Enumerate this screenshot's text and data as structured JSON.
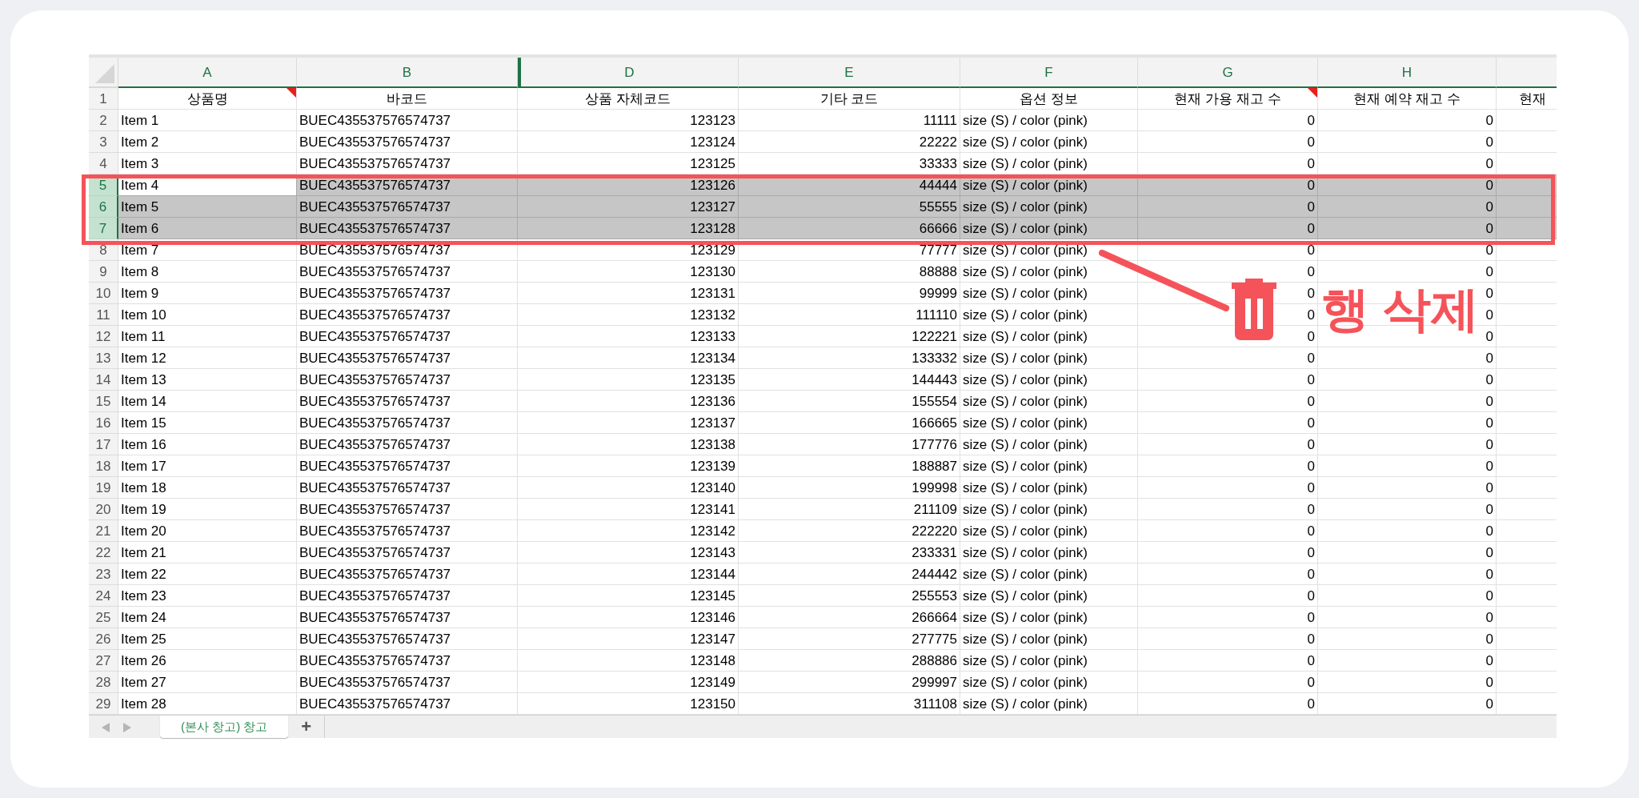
{
  "column_letters": [
    "A",
    "B",
    "D",
    "E",
    "F",
    "G",
    "H"
  ],
  "header_row": {
    "number": "1",
    "cells": [
      {
        "text": "상품명",
        "comment": true
      },
      {
        "text": "바코드",
        "comment": false
      },
      {
        "text": "상품 자체코드",
        "comment": false
      },
      {
        "text": "기타 코드",
        "comment": false
      },
      {
        "text": "옵션 정보",
        "comment": false
      },
      {
        "text": "현재 가용 재고 수",
        "comment": true
      },
      {
        "text": "현재 예약 재고 수",
        "comment": false
      },
      {
        "text": "현재",
        "comment": false
      }
    ]
  },
  "rows": [
    {
      "number": "2",
      "selected": false,
      "active": false,
      "cells": [
        "Item 1",
        "BUEC435537576574737",
        "123123",
        "11111",
        "size (S) / color (pink)",
        "0",
        "0"
      ]
    },
    {
      "number": "3",
      "selected": false,
      "active": false,
      "cells": [
        "Item 2",
        "BUEC435537576574737",
        "123124",
        "22222",
        "size (S) / color (pink)",
        "0",
        "0"
      ]
    },
    {
      "number": "4",
      "selected": false,
      "active": false,
      "cells": [
        "Item 3",
        "BUEC435537576574737",
        "123125",
        "33333",
        "size (S) / color (pink)",
        "0",
        "0"
      ]
    },
    {
      "number": "5",
      "selected": true,
      "active": true,
      "cells": [
        "Item 4",
        "BUEC435537576574737",
        "123126",
        "44444",
        "size (S) / color (pink)",
        "0",
        "0"
      ]
    },
    {
      "number": "6",
      "selected": true,
      "active": false,
      "cells": [
        "Item 5",
        "BUEC435537576574737",
        "123127",
        "55555",
        "size (S) / color (pink)",
        "0",
        "0"
      ]
    },
    {
      "number": "7",
      "selected": true,
      "active": false,
      "cells": [
        "Item 6",
        "BUEC435537576574737",
        "123128",
        "66666",
        "size (S) / color (pink)",
        "0",
        "0"
      ]
    },
    {
      "number": "8",
      "selected": false,
      "active": false,
      "cells": [
        "Item 7",
        "BUEC435537576574737",
        "123129",
        "77777",
        "size (S) / color (pink)",
        "0",
        "0"
      ]
    },
    {
      "number": "9",
      "selected": false,
      "active": false,
      "cells": [
        "Item 8",
        "BUEC435537576574737",
        "123130",
        "88888",
        "size (S) / color (pink)",
        "0",
        "0"
      ]
    },
    {
      "number": "10",
      "selected": false,
      "active": false,
      "cells": [
        "Item 9",
        "BUEC435537576574737",
        "123131",
        "99999",
        "size (S) / color (pink)",
        "0",
        "0"
      ]
    },
    {
      "number": "11",
      "selected": false,
      "active": false,
      "cells": [
        "Item 10",
        "BUEC435537576574737",
        "123132",
        "111110",
        "size (S) / color (pink)",
        "0",
        "0"
      ]
    },
    {
      "number": "12",
      "selected": false,
      "active": false,
      "cells": [
        "Item 11",
        "BUEC435537576574737",
        "123133",
        "122221",
        "size (S) / color (pink)",
        "0",
        "0"
      ]
    },
    {
      "number": "13",
      "selected": false,
      "active": false,
      "cells": [
        "Item 12",
        "BUEC435537576574737",
        "123134",
        "133332",
        "size (S) / color (pink)",
        "0",
        "0"
      ]
    },
    {
      "number": "14",
      "selected": false,
      "active": false,
      "cells": [
        "Item 13",
        "BUEC435537576574737",
        "123135",
        "144443",
        "size (S) / color (pink)",
        "0",
        "0"
      ]
    },
    {
      "number": "15",
      "selected": false,
      "active": false,
      "cells": [
        "Item 14",
        "BUEC435537576574737",
        "123136",
        "155554",
        "size (S) / color (pink)",
        "0",
        "0"
      ]
    },
    {
      "number": "16",
      "selected": false,
      "active": false,
      "cells": [
        "Item 15",
        "BUEC435537576574737",
        "123137",
        "166665",
        "size (S) / color (pink)",
        "0",
        "0"
      ]
    },
    {
      "number": "17",
      "selected": false,
      "active": false,
      "cells": [
        "Item 16",
        "BUEC435537576574737",
        "123138",
        "177776",
        "size (S) / color (pink)",
        "0",
        "0"
      ]
    },
    {
      "number": "18",
      "selected": false,
      "active": false,
      "cells": [
        "Item 17",
        "BUEC435537576574737",
        "123139",
        "188887",
        "size (S) / color (pink)",
        "0",
        "0"
      ]
    },
    {
      "number": "19",
      "selected": false,
      "active": false,
      "cells": [
        "Item 18",
        "BUEC435537576574737",
        "123140",
        "199998",
        "size (S) / color (pink)",
        "0",
        "0"
      ]
    },
    {
      "number": "20",
      "selected": false,
      "active": false,
      "cells": [
        "Item 19",
        "BUEC435537576574737",
        "123141",
        "211109",
        "size (S) / color (pink)",
        "0",
        "0"
      ]
    },
    {
      "number": "21",
      "selected": false,
      "active": false,
      "cells": [
        "Item 20",
        "BUEC435537576574737",
        "123142",
        "222220",
        "size (S) / color (pink)",
        "0",
        "0"
      ]
    },
    {
      "number": "22",
      "selected": false,
      "active": false,
      "cells": [
        "Item 21",
        "BUEC435537576574737",
        "123143",
        "233331",
        "size (S) / color (pink)",
        "0",
        "0"
      ]
    },
    {
      "number": "23",
      "selected": false,
      "active": false,
      "cells": [
        "Item 22",
        "BUEC435537576574737",
        "123144",
        "244442",
        "size (S) / color (pink)",
        "0",
        "0"
      ]
    },
    {
      "number": "24",
      "selected": false,
      "active": false,
      "cells": [
        "Item 23",
        "BUEC435537576574737",
        "123145",
        "255553",
        "size (S) / color (pink)",
        "0",
        "0"
      ]
    },
    {
      "number": "25",
      "selected": false,
      "active": false,
      "cells": [
        "Item 24",
        "BUEC435537576574737",
        "123146",
        "266664",
        "size (S) / color (pink)",
        "0",
        "0"
      ]
    },
    {
      "number": "26",
      "selected": false,
      "active": false,
      "cells": [
        "Item 25",
        "BUEC435537576574737",
        "123147",
        "277775",
        "size (S) / color (pink)",
        "0",
        "0"
      ]
    },
    {
      "number": "27",
      "selected": false,
      "active": false,
      "cells": [
        "Item 26",
        "BUEC435537576574737",
        "123148",
        "288886",
        "size (S) / color (pink)",
        "0",
        "0"
      ]
    },
    {
      "number": "28",
      "selected": false,
      "active": false,
      "cells": [
        "Item 27",
        "BUEC435537576574737",
        "123149",
        "299997",
        "size (S) / color (pink)",
        "0",
        "0"
      ]
    },
    {
      "number": "29",
      "selected": false,
      "active": false,
      "cells": [
        "Item 28",
        "BUEC435537576574737",
        "123150",
        "311108",
        "size (S) / color (pink)",
        "0",
        "0"
      ]
    }
  ],
  "sheet_tabs": [
    {
      "label": "(본사 창고) 창고",
      "selected": true
    }
  ],
  "add_sheet": "+",
  "annotation": {
    "label": "행 삭제"
  }
}
